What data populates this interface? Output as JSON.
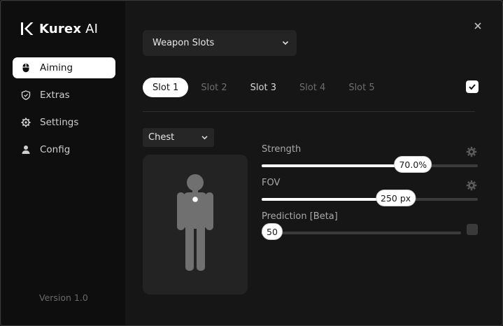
{
  "app": {
    "brand_strong": "Kurex",
    "brand_light": " AI",
    "version": "Version 1.0"
  },
  "sidebar": {
    "items": [
      {
        "label": "Aiming",
        "icon": "mouse-icon",
        "active": true
      },
      {
        "label": "Extras",
        "icon": "shield-icon",
        "active": false
      },
      {
        "label": "Settings",
        "icon": "gear-icon",
        "active": false
      },
      {
        "label": "Config",
        "icon": "user-icon",
        "active": false
      }
    ]
  },
  "weapon_select": {
    "value": "Weapon Slots",
    "icon": "chevron-down-icon"
  },
  "slots": [
    "Slot 1",
    "Slot 2",
    "Slot 3",
    "Slot 4",
    "Slot 5"
  ],
  "slot_enabled": true,
  "bone_select": {
    "value": "Chest",
    "icon": "chevron-down-icon"
  },
  "settings": {
    "strength": {
      "label": "Strength",
      "value_text": "70.0%",
      "fraction": 0.7
    },
    "fov": {
      "label": "FOV",
      "value_text": "250 px",
      "fraction": 0.62
    },
    "prediction": {
      "label": "Prediction [Beta]",
      "value_text": "50",
      "fraction": 0.05,
      "enabled": false
    }
  },
  "colors": {
    "background": "#161616",
    "sidebar": "#0e0e0e",
    "accent": "#ffffff",
    "panel": "#232323"
  }
}
